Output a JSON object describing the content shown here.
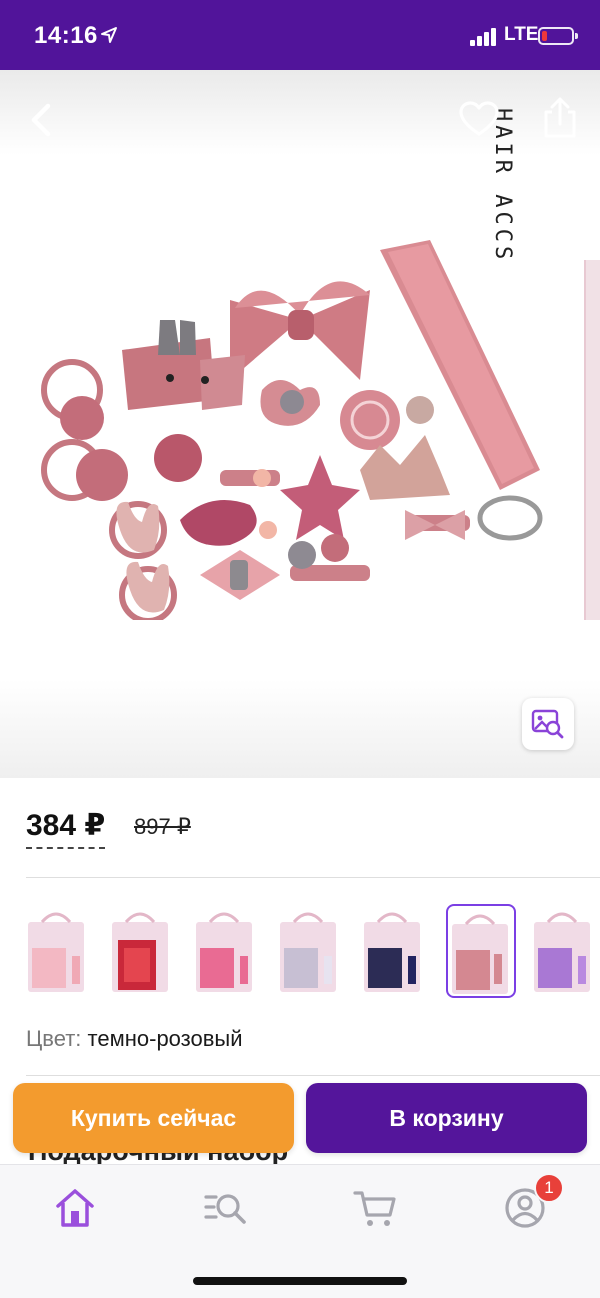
{
  "status_bar": {
    "time": "14:16",
    "network": "LTE",
    "icons": [
      "location-arrow-icon",
      "signal-icon",
      "battery-icon"
    ]
  },
  "gallery": {
    "brand_text": "HAIR ACCS",
    "icons": [
      "back-arrow-icon",
      "heart-icon",
      "share-icon",
      "image-search-icon"
    ]
  },
  "price": {
    "current": "384 ₽",
    "old": "897 ₽"
  },
  "variants": {
    "count": 7,
    "selected_index": 5
  },
  "color": {
    "label": "Цвет:",
    "value": "темно-розовый"
  },
  "product": {
    "title_partial": "Подарочный набор"
  },
  "actions": {
    "buy_now": "Купить сейчас",
    "add_to_cart": "В корзину"
  },
  "nav": {
    "items": [
      "home-icon",
      "catalog-search-icon",
      "cart-icon",
      "profile-icon"
    ],
    "profile_badge": "1"
  },
  "colors": {
    "brand_purple": "#51149a",
    "buy_now_orange": "#f39b2e",
    "selected_outline": "#7b3fe4",
    "active_nav": "#9a4fdc",
    "badge_red": "#e8403a",
    "product_pink": "#c9727f"
  }
}
